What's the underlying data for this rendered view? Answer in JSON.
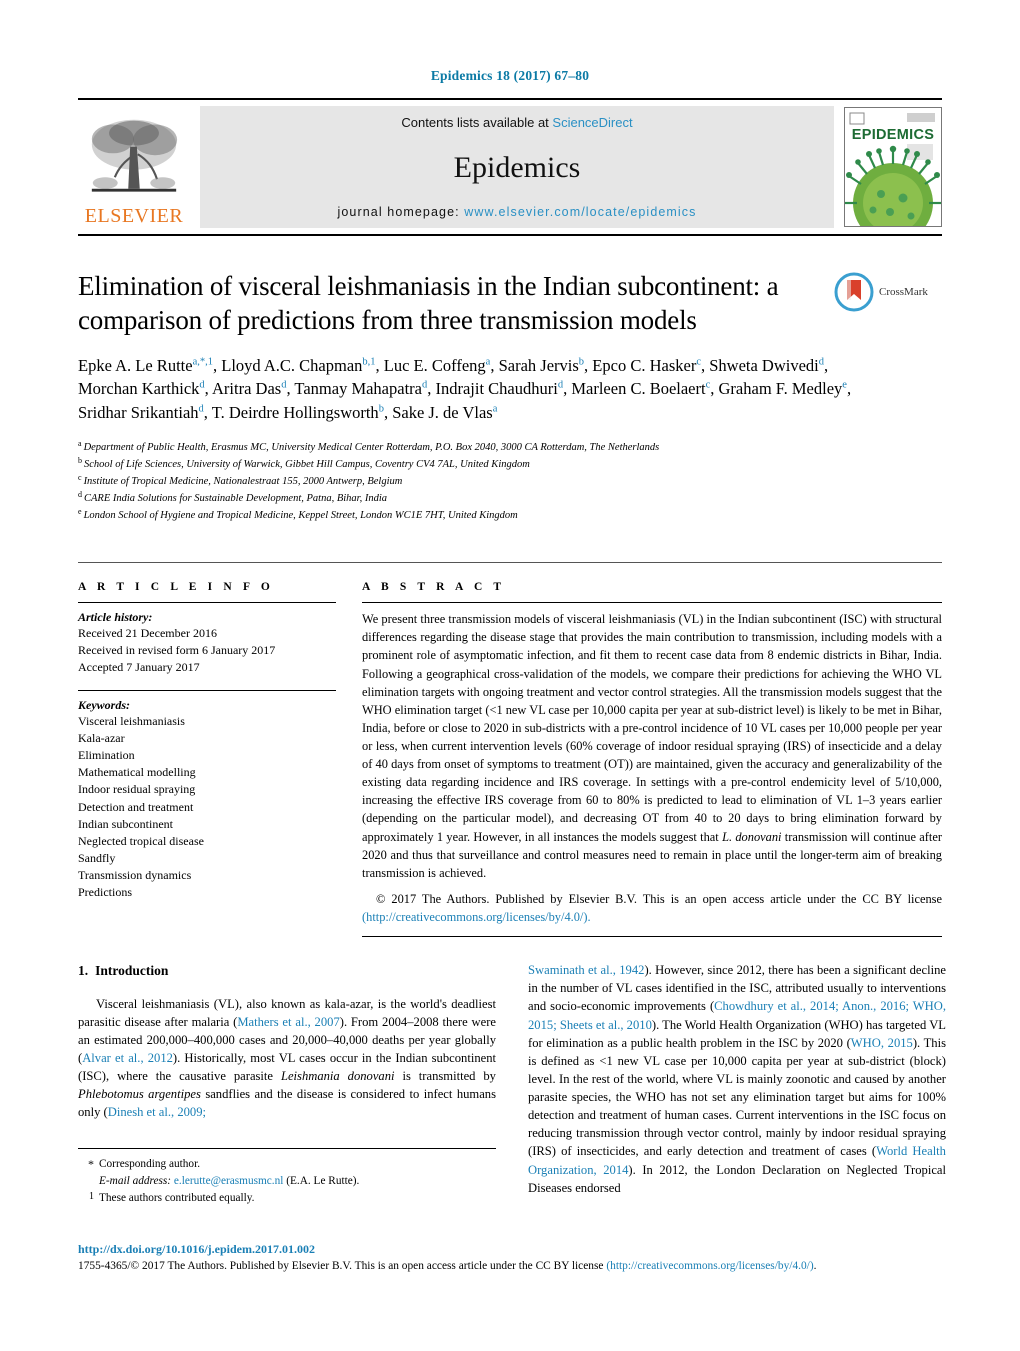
{
  "running_head": "Epidemics 18 (2017) 67–80",
  "masthead": {
    "contents_prefix": "Contents lists available at ",
    "sciencedirect": "ScienceDirect",
    "journal_name": "Epidemics",
    "homepage_prefix": "journal homepage: ",
    "homepage_url": "www.elsevier.com/locate/epidemics",
    "publisher_logo_word": "ELSEVIER",
    "cover_title": "EPIDEMICS",
    "link_color": "#2a90c4",
    "logo_color": "#e87722"
  },
  "article": {
    "title": "Elimination of visceral leishmaniasis in the Indian subcontinent: a comparison of predictions from three transmission models",
    "crossmark_label": "CrossMark",
    "authors_html": "Epke A. Le Rutte<sup>a,*,1</sup>, Lloyd A.C. Chapman<sup>b,1</sup>, Luc E. Coffeng<sup>a</sup>, Sarah Jervis<sup>b</sup>, Epco C. Hasker<sup>c</sup>, Shweta Dwivedi<sup>d</sup>, Morchan Karthick<sup>d</sup>, Aritra Das<sup>d</sup>, Tanmay Mahapatra<sup>d</sup>, Indrajit Chaudhuri<sup>d</sup>, Marleen C. Boelaert<sup>c</sup>, Graham F. Medley<sup>e</sup>, Sridhar Srikantiah<sup>d</sup>, T. Deirdre Hollingsworth<sup>b</sup>, Sake J. de Vlas<sup>a</sup>",
    "affiliations": [
      {
        "mark": "a",
        "text": "Department of Public Health, Erasmus MC, University Medical Center Rotterdam, P.O. Box 2040, 3000 CA Rotterdam, The Netherlands"
      },
      {
        "mark": "b",
        "text": "School of Life Sciences, University of Warwick, Gibbet Hill Campus, Coventry CV4 7AL, United Kingdom"
      },
      {
        "mark": "c",
        "text": "Institute of Tropical Medicine, Nationalestraat 155, 2000 Antwerp, Belgium"
      },
      {
        "mark": "d",
        "text": "CARE India Solutions for Sustainable Development, Patna, Bihar, India"
      },
      {
        "mark": "e",
        "text": "London School of Hygiene and Tropical Medicine, Keppel Street, London WC1E 7HT, United Kingdom"
      }
    ]
  },
  "article_info": {
    "heading": "A R T I C L E    I N F O",
    "history_label": "Article history:",
    "history": [
      "Received 21 December 2016",
      "Received in revised form 6 January 2017",
      "Accepted 7 January 2017"
    ],
    "keywords_label": "Keywords:",
    "keywords": [
      "Visceral leishmaniasis",
      "Kala-azar",
      "Elimination",
      "Mathematical modelling",
      "Indoor residual spraying",
      "Detection and treatment",
      "Indian subcontinent",
      "Neglected tropical disease",
      "Sandfly",
      "Transmission dynamics",
      "Predictions"
    ]
  },
  "abstract": {
    "heading": "A B S T R A C T",
    "body_html": "We present three transmission models of visceral leishmaniasis (VL) in the Indian subcontinent (ISC) with structural differences regarding the disease stage that provides the main contribution to transmission, including models with a prominent role of asymptomatic infection, and fit them to recent case data from 8 endemic districts in Bihar, India. Following a geographical cross-validation of the models, we compare their predictions for achieving the WHO VL elimination targets with ongoing treatment and vector control strategies. All the transmission models suggest that the WHO elimination target (&lt;1 new VL case per 10,000 capita per year at sub-district level) is likely to be met in Bihar, India, before or close to 2020 in sub-districts with a pre-control incidence of 10 VL cases per 10,000 people per year or less, when current intervention levels (60% coverage of indoor residual spraying (IRS) of insecticide and a delay of 40 days from onset of symptoms to treatment (OT)) are maintained, given the accuracy and generalizability of the existing data regarding incidence and IRS coverage. In settings with a pre-control endemicity level of 5/10,000, increasing the effective IRS coverage from 60 to 80% is predicted to lead to elimination of VL 1–3 years earlier (depending on the particular model), and decreasing OT from 40 to 20 days to bring elimination forward by approximately 1 year. However, in all instances the models suggest that <i>L. donovani</i> transmission will continue after 2020 and thus that surveillance and control measures need to remain in place until the longer-term aim of breaking transmission is achieved.",
    "copyright_text": "© 2017 The Authors. Published by Elsevier B.V. This is an open access article under the CC BY license",
    "license_url": "(http://creativecommons.org/licenses/by/4.0/)."
  },
  "body": {
    "section_number": "1.",
    "section_title": "Introduction",
    "left_column_html": "Visceral leishmaniasis (VL), also known as kala-azar, is the world's deadliest parasitic disease after malaria (<span class=\"cite\">Mathers et al., 2007</span>). From 2004–2008 there were an estimated 200,000–400,000 cases and 20,000–40,000 deaths per year globally (<span class=\"cite\">Alvar et al., 2012</span>). Historically, most VL cases occur in the Indian subcontinent (ISC), where the causative parasite <i>Leishmania donovani</i> is transmitted by <i>Phlebotomus argentipes</i> sandflies and the disease is considered to infect humans only (<span class=\"cite\">Dinesh et al., 2009;</span>",
    "right_column_html": "<span class=\"cite\">Swaminath et al., 1942</span>). However, since 2012, there has been a significant decline in the number of VL cases identified in the ISC, attributed usually to interventions and socio-economic improvements (<span class=\"cite\">Chowdhury et al., 2014; Anon., 2016; WHO, 2015; Sheets et al., 2010</span>). The World Health Organization (WHO) has targeted VL for elimination as a public health problem in the ISC by 2020 (<span class=\"cite\">WHO, 2015</span>). This is defined as &lt;1 new VL case per 10,000 capita per year at sub-district (block) level. In the rest of the world, where VL is mainly zoonotic and caused by another parasite species, the WHO has not set any elimination target but aims for 100% detection and treatment of human cases. Current interventions in the ISC focus on reducing transmission through vector control, mainly by indoor residual spraying (IRS) of insecticides, and early detection and treatment of cases (<span class=\"cite\">World Health Organization, 2014</span>). In 2012, the London Declaration on Neglected Tropical Diseases endorsed"
  },
  "footnotes": {
    "corresponding_mark": "*",
    "corresponding_text": "Corresponding author.",
    "email_label": "E-mail address:",
    "email": "e.lerutte@erasmusmc.nl",
    "email_suffix": "(E.A. Le Rutte).",
    "equal_mark": "1",
    "equal_text": "These authors contributed equally."
  },
  "page_footer": {
    "doi": "http://dx.doi.org/10.1016/j.epidem.2017.01.002",
    "issn_line": "1755-4365/© 2017 The Authors. Published by Elsevier B.V. This is an open access article under the CC BY license ",
    "license_url": "(http://creativecommons.org/licenses/by/4.0/)",
    "license_tail": "."
  }
}
